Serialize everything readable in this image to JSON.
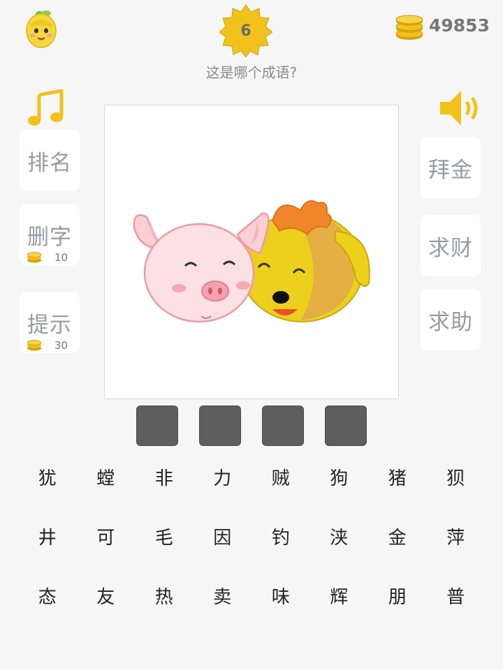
{
  "header": {
    "level": "6",
    "question": "这是哪个成语?",
    "coins": "49853"
  },
  "left_buttons": [
    {
      "label": "排名"
    },
    {
      "label": "删字",
      "cost": "10"
    },
    {
      "label": "提示",
      "cost": "30"
    }
  ],
  "right_buttons": [
    {
      "label": "拜金"
    },
    {
      "label": "求财"
    },
    {
      "label": "求助"
    }
  ],
  "answer_slots": [
    "",
    "",
    "",
    ""
  ],
  "characters": [
    "犹",
    "螳",
    "非",
    "力",
    "贼",
    "狗",
    "猪",
    "狈",
    "井",
    "可",
    "毛",
    "因",
    "钓",
    "浃",
    "金",
    "萍",
    "态",
    "友",
    "热",
    "卖",
    "味",
    "辉",
    "朋",
    "普"
  ],
  "colors": {
    "background": "#f6f6f6",
    "slot": "#5e5e5e",
    "accent_gold": "#f2c21b",
    "button_text": "#9a9aa6"
  },
  "icons": [
    "avatar-icon",
    "level-star-icon",
    "coin-stack-icon",
    "music-note-icon",
    "speaker-icon",
    "coin-icon"
  ]
}
